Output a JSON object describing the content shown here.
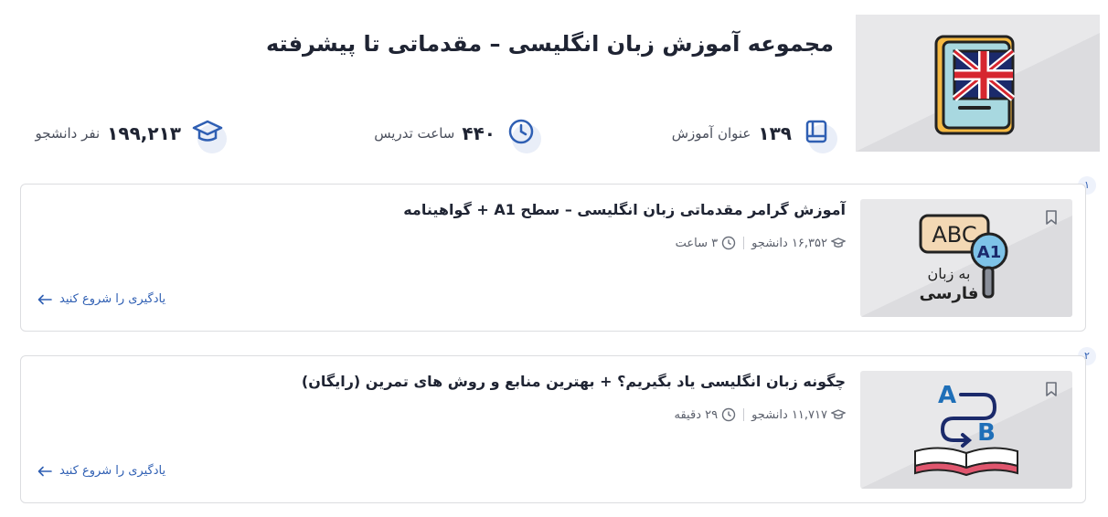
{
  "header": {
    "title": "مجموعه آموزش زبان انگلیسی – مقدماتی تا پیشرفته",
    "stats": [
      {
        "value": "۱۳۹",
        "label": "عنوان آموزش",
        "icon": "books-icon"
      },
      {
        "value": "۴۴۰",
        "label": "ساعت تدریس",
        "icon": "clock-icon"
      },
      {
        "value": "۱۹۹,۲۱۳",
        "label": "نفر دانشجو",
        "icon": "graduation-cap-icon"
      }
    ]
  },
  "courses": [
    {
      "index": "۱",
      "title": "آموزش گرامر مقدماتی زبان انگلیسی – سطح A1 + گواهینامه",
      "students": "۱۶,۳۵۲ دانشجو",
      "duration": "۳ ساعت",
      "start_label": "یادگیری را شروع کنید"
    },
    {
      "index": "۲",
      "title": "چگونه زبان انگلیسی یاد بگیریم؟ + بهترین منابع و روش های تمرین (رایگان)",
      "students": "۱۱,۷۱۷ دانشجو",
      "duration": "۲۹ دقیقه",
      "start_label": "یادگیری را شروع کنید"
    }
  ],
  "thumb1_text": {
    "abc": "ABC",
    "level": "A1",
    "line1": "به زبان",
    "line2": "فارسی"
  },
  "thumb2_text": {
    "a": "A",
    "b": "B"
  },
  "colors": {
    "accent": "#2f5fb3",
    "border": "#dcdde0",
    "thumb_bg": "#e8e8ea"
  }
}
